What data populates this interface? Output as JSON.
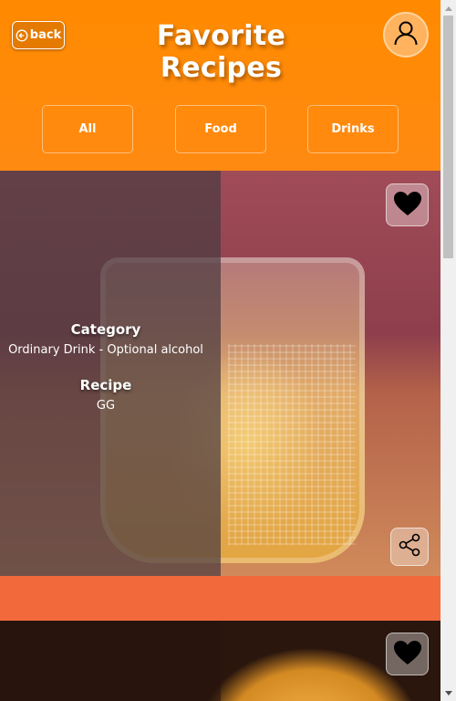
{
  "header": {
    "back_label": "back",
    "title": "Favorite Recipes",
    "avatar_icon": "user-icon"
  },
  "filters": [
    {
      "label": "All"
    },
    {
      "label": "Food"
    },
    {
      "label": "Drinks"
    }
  ],
  "recipes": [
    {
      "category_heading": "Category",
      "category": "Ordinary Drink - Optional alcohol",
      "recipe_heading": "Recipe",
      "recipe": "GG",
      "favorite_icon": "heart-icon",
      "share_icon": "share-icon"
    },
    {
      "favorite_icon": "heart-icon"
    }
  ],
  "colors": {
    "header_orange": "#ff8a00",
    "page_background": "#f26a3c",
    "overlay": "#4b3c41"
  }
}
